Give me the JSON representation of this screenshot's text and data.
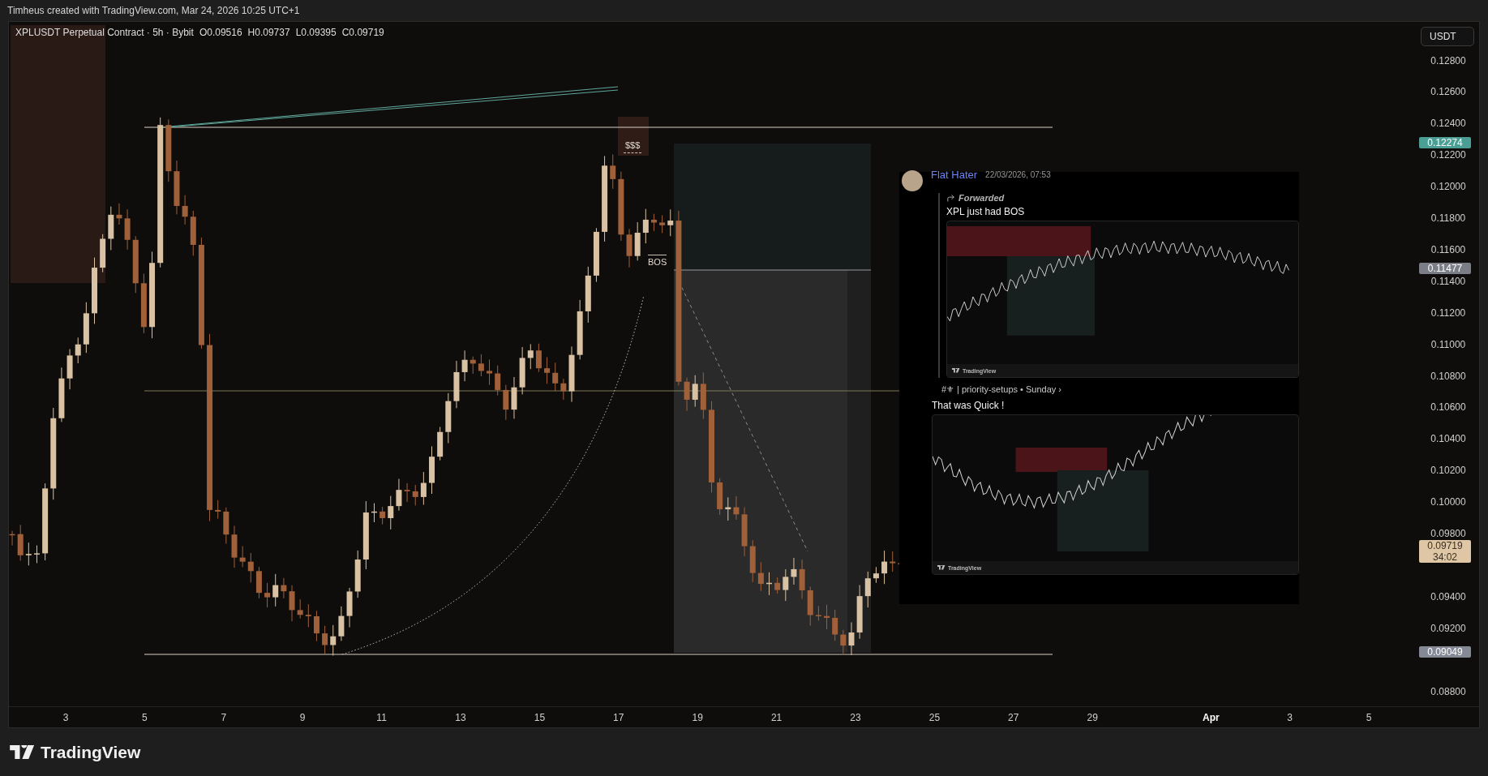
{
  "header": {
    "text": "Timheus created with TradingView.com, Mar 24, 2026 10:25 UTC+1"
  },
  "legend": {
    "symbol": "XPLUSDT Perpetual Contract · 5h · Bybit",
    "ohlc": [
      "O0.09516",
      "H0.09737",
      "L0.09395",
      "C0.09719"
    ]
  },
  "currency_button": "USDT",
  "price_axis": [
    "0.12800",
    "0.12600",
    "0.12400",
    "0.12200",
    "0.12000",
    "0.11800",
    "0.11600",
    "0.11400",
    "0.11200",
    "0.11000",
    "0.10800",
    "0.10600",
    "0.10400",
    "0.10200",
    "0.10000",
    "0.09800",
    "0.09400",
    "0.09200",
    "0.08800"
  ],
  "price_badges": [
    {
      "kind": "marker",
      "value": "0.12274",
      "color": "#4a9e93"
    },
    {
      "kind": "marker",
      "value": "0.11477",
      "color": "#7b7e87"
    },
    {
      "kind": "last",
      "value": "0.09719",
      "countdown": "34:02",
      "color": "#dfc6a4"
    },
    {
      "kind": "marker",
      "value": "0.09049",
      "color": "#858995"
    }
  ],
  "annotations": [
    {
      "kind": "liquidity",
      "text": "$$$"
    },
    {
      "kind": "structure",
      "text": "BOS"
    }
  ],
  "date_axis": [
    {
      "label": "3",
      "emphasized": false
    },
    {
      "label": "5",
      "emphasized": false
    },
    {
      "label": "7",
      "emphasized": false
    },
    {
      "label": "9",
      "emphasized": false
    },
    {
      "label": "11",
      "emphasized": false
    },
    {
      "label": "13",
      "emphasized": false
    },
    {
      "label": "15",
      "emphasized": false
    },
    {
      "label": "17",
      "emphasized": false
    },
    {
      "label": "19",
      "emphasized": false
    },
    {
      "label": "21",
      "emphasized": false
    },
    {
      "label": "23",
      "emphasized": false
    },
    {
      "label": "25",
      "emphasized": false
    },
    {
      "label": "27",
      "emphasized": false
    },
    {
      "label": "29",
      "emphasized": false
    },
    {
      "label": "Apr",
      "emphasized": true
    },
    {
      "label": "3",
      "emphasized": false
    },
    {
      "label": "5",
      "emphasized": false
    }
  ],
  "message": {
    "author": "Flat Hater",
    "timestamp": "22/03/2026, 07:53",
    "forwarded_label": "Forwarded",
    "forwarded_text": "XPL just had BOS",
    "image_brand": "TradingView",
    "source": "#⚜ | priority-setups • Sunday ›",
    "reply_text": "That was Quick !",
    "reply_image_brand": "TradingView"
  },
  "footer": {
    "brand": "TradingView"
  }
}
